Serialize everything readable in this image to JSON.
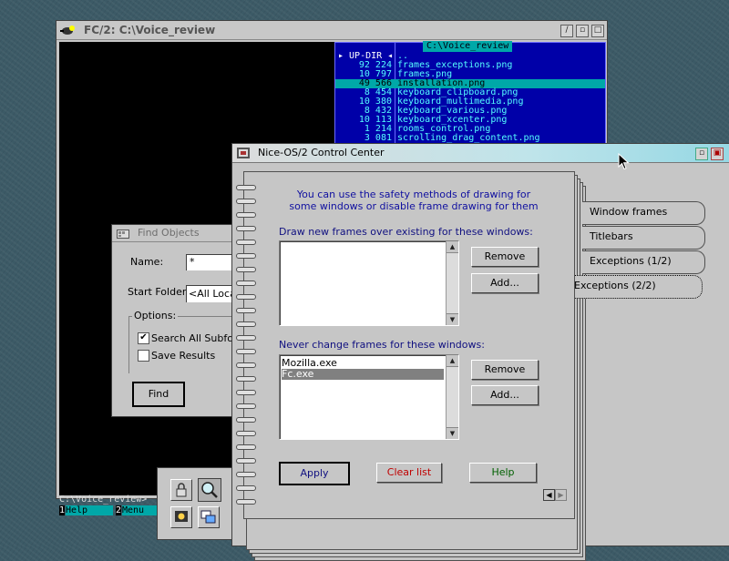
{
  "fc_window": {
    "title": "FC/2:  C:\\Voice_review",
    "panel": {
      "title": "C:\\Voice_review",
      "rows": [
        {
          "size": "▸ UP-DIR ◂",
          "name": ".."
        },
        {
          "size": "92 224",
          "name": "frames_exceptions.png"
        },
        {
          "size": "10 797",
          "name": "frames.png"
        },
        {
          "size": "49 566",
          "name": "installation.png"
        },
        {
          "size": "8 454",
          "name": "keyboard_clipboard.png"
        },
        {
          "size": "10 380",
          "name": "keyboard_multimedia.png"
        },
        {
          "size": "8 432",
          "name": "keyboard_various.png"
        },
        {
          "size": "10 113",
          "name": "keyboard_xcenter.png"
        },
        {
          "size": "1 214",
          "name": "rooms_control.png"
        },
        {
          "size": "3 081",
          "name": "scrolling_drag_content.png"
        }
      ]
    },
    "prompt": "C:\\Voice_review>",
    "keys": [
      {
        "num": "1",
        "label": "Help"
      },
      {
        "num": "2",
        "label": "Menu"
      }
    ]
  },
  "find_window": {
    "title": "Find Objects",
    "name_label": "Name:",
    "name_value": "*",
    "start_folder_label": "Start Folder:",
    "start_folder_value": "<All Local",
    "options_label": "Options:",
    "search_all": "Search All Subfolders",
    "save_results": "Save Results",
    "find_button": "Find"
  },
  "control_center": {
    "title": "Nice-OS/2 Control Center",
    "description": "You can use the safety methods of drawing for some windows or disable frame drawing for them",
    "draw_label": "Draw new frames over existing for these windows:",
    "never_label": "Never change frames for these windows:",
    "remove_label": "Remove",
    "add_label": "Add...",
    "never_items": [
      "Mozilla.exe",
      "Fc.exe"
    ],
    "apply_label": "Apply",
    "clear_label": "Clear list",
    "help_label": "Help",
    "tabs": [
      "Window frames",
      "Titlebars",
      "Exceptions (1/2)",
      "Exceptions (2/2)"
    ]
  }
}
